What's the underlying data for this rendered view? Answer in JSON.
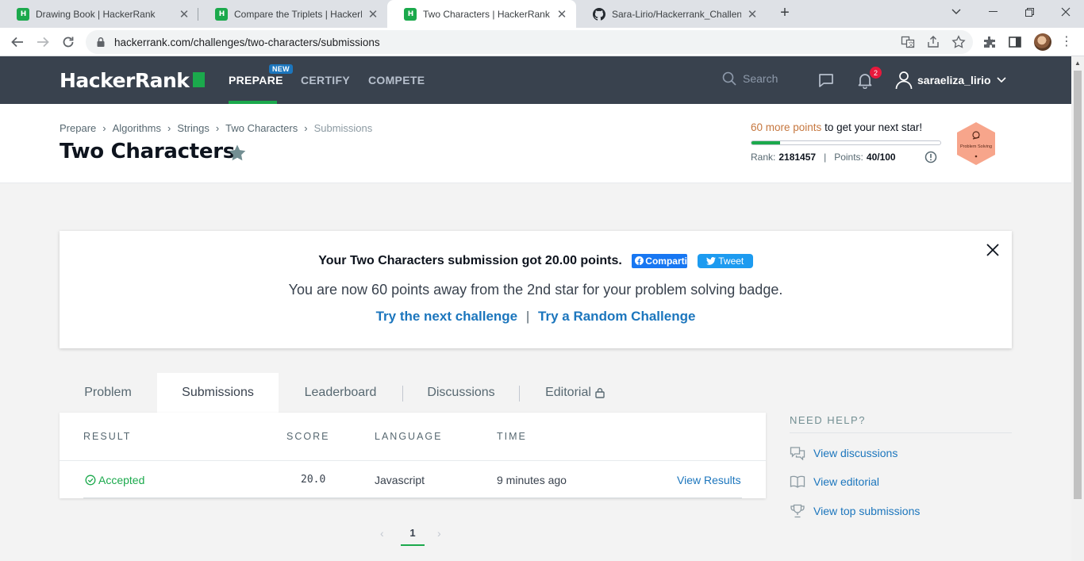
{
  "browser": {
    "tabs": [
      {
        "title": "Drawing Book | HackerRank",
        "active": false
      },
      {
        "title": "Compare the Triplets | HackerRank",
        "active": false
      },
      {
        "title": "Two Characters | HackerRank",
        "active": true
      },
      {
        "title": "Sara-Lirio/Hackerrank_Challenges",
        "active": false
      }
    ],
    "new_tab": "+",
    "url": "hackerrank.com/challenges/two-characters/submissions"
  },
  "nav": {
    "logo": "HackerRank",
    "items": [
      "PREPARE",
      "CERTIFY",
      "COMPETE"
    ],
    "new_badge": "NEW",
    "search_placeholder": "Search",
    "notifications_count": "2",
    "username": "saraeliza_lirio"
  },
  "header": {
    "breadcrumb": [
      "Prepare",
      "Algorithms",
      "Strings",
      "Two Characters",
      "Submissions"
    ],
    "title": "Two Characters",
    "stars_points": "60 more points",
    "stars_rest": "to get your next star!",
    "progress_fraction": 0.15,
    "rank_label": "Rank:",
    "rank_value": "2181457",
    "points_label": "Points:",
    "points_value": "40/100",
    "badge_label": "Problem Solving",
    "badge_color": "#f7a58b"
  },
  "success": {
    "headline": "Your Two Characters submission got 20.00 points.",
    "fb_label": "Compartilhar",
    "tweet_label": "Tweet",
    "message": "You are now 60 points away from the 2nd star for your problem solving badge.",
    "next_link": "Try the next challenge",
    "separator": "|",
    "random_link": "Try a Random Challenge"
  },
  "tabs": [
    "Problem",
    "Submissions",
    "Leaderboard",
    "Discussions",
    "Editorial"
  ],
  "table": {
    "headers": [
      "RESULT",
      "SCORE",
      "LANGUAGE",
      "TIME"
    ],
    "rows": [
      {
        "result": "Accepted",
        "score": "20.0",
        "language": "Javascript",
        "time": "9 minutes ago",
        "action": "View Results"
      }
    ]
  },
  "help": {
    "title": "NEED HELP?",
    "items": [
      "View discussions",
      "View editorial",
      "View top submissions"
    ]
  },
  "pagination": {
    "current": "1"
  },
  "colors": {
    "accent_green": "#1ba94c",
    "link_blue": "#1c76bd",
    "nav_bg": "#39424e"
  }
}
